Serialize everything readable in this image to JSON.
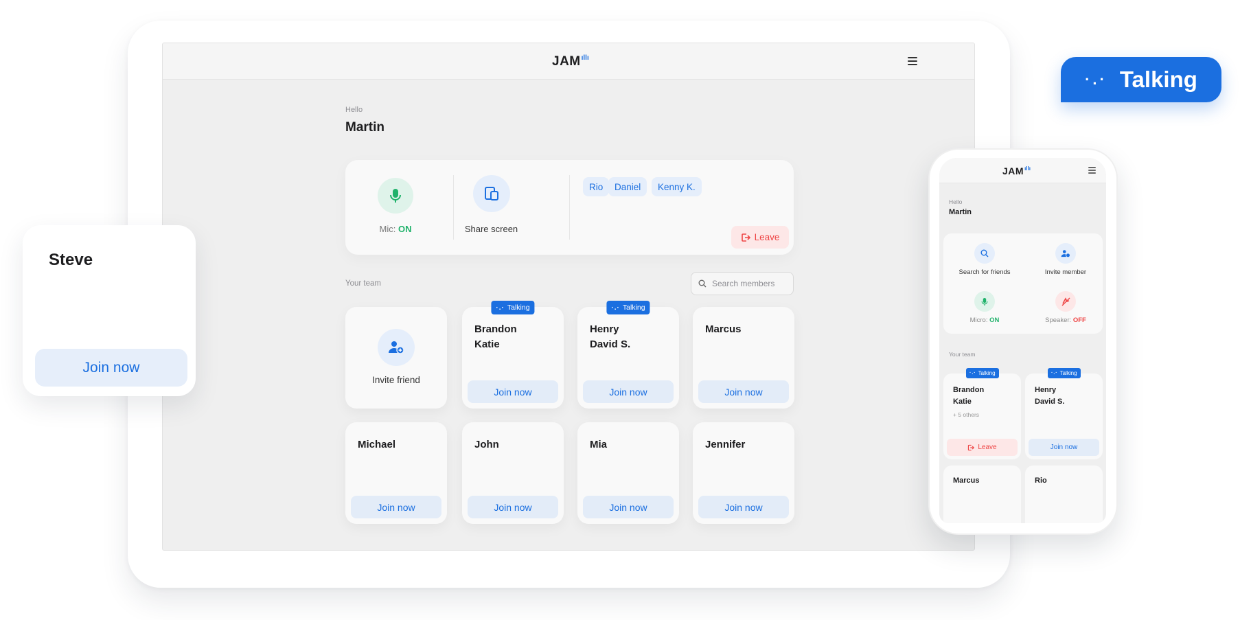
{
  "colors": {
    "accent": "#1b6fe0",
    "on": "#20b26b",
    "off": "#ee4545"
  },
  "app": {
    "logo": "JAM"
  },
  "greeting": {
    "hello": "Hello",
    "name": "Martin"
  },
  "controls": {
    "mic": {
      "label_prefix": "Mic:",
      "state": "ON",
      "icon": "mic-icon"
    },
    "share": {
      "label": "Share screen",
      "icon": "share-screen-icon"
    },
    "participants": [
      "Rio",
      "Daniel",
      "Kenny K."
    ],
    "leave_label": "Leave"
  },
  "team": {
    "label": "Your team",
    "search_placeholder": "Search members",
    "invite_label": "Invite friend",
    "talking_label": "Talking",
    "join_label": "Join now",
    "cards": [
      {
        "names": [
          "Brandon",
          "Katie"
        ],
        "talking": true
      },
      {
        "names": [
          "Henry",
          "David S."
        ],
        "talking": true
      },
      {
        "names": [
          "Marcus"
        ],
        "talking": false
      },
      {
        "names": [
          "Michael"
        ],
        "talking": false
      },
      {
        "names": [
          "John"
        ],
        "talking": false
      },
      {
        "names": [
          "Mia"
        ],
        "talking": false
      },
      {
        "names": [
          "Jennifer"
        ],
        "talking": false
      }
    ]
  },
  "floating_card": {
    "name": "Steve",
    "join_label": "Join now"
  },
  "talking_pill": {
    "label": "Talking"
  },
  "phone": {
    "logo": "JAM",
    "hello": "Hello",
    "name": "Martin",
    "actions": {
      "search": "Search for friends",
      "invite": "Invite member",
      "micro_prefix": "Micro:",
      "micro_state": "ON",
      "speaker_prefix": "Speaker:",
      "speaker_state": "OFF"
    },
    "team_label": "Your team",
    "talking_label": "Talking",
    "cards": [
      {
        "names": [
          "Brandon",
          "Katie"
        ],
        "extra": "+ 5 others",
        "button": "Leave"
      },
      {
        "names": [
          "Henry",
          "David S."
        ],
        "button": "Join now"
      },
      {
        "names": [
          "Marcus"
        ]
      },
      {
        "names": [
          "Rio"
        ]
      }
    ]
  }
}
